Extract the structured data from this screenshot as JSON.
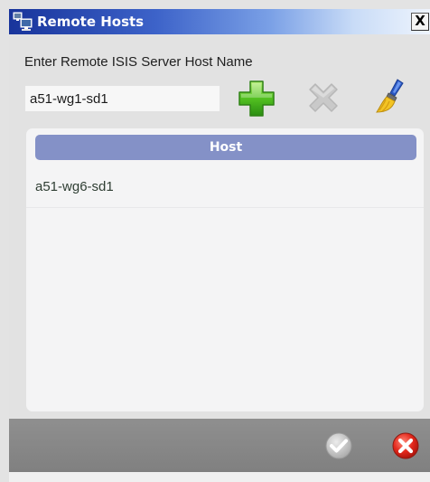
{
  "window": {
    "title": "Remote Hosts",
    "close_label": "X",
    "title_icon": "network-hosts-icon",
    "colors": {
      "titlebar_start": "#18349b",
      "titlebar_end": "#eef4fd",
      "header": "#8491c7",
      "footer": "#888888"
    }
  },
  "form": {
    "prompt": "Enter Remote ISIS Server Host Name",
    "host_value": "a51-wg1-sd1",
    "add_icon": "plus-icon",
    "remove_icon": "x-icon",
    "clear_icon": "brush-icon"
  },
  "hosts_table": {
    "column_header": "Host",
    "rows": [
      "a51-wg6-sd1"
    ]
  },
  "footer": {
    "ok_icon": "checkmark-icon",
    "cancel_icon": "cancel-icon"
  }
}
